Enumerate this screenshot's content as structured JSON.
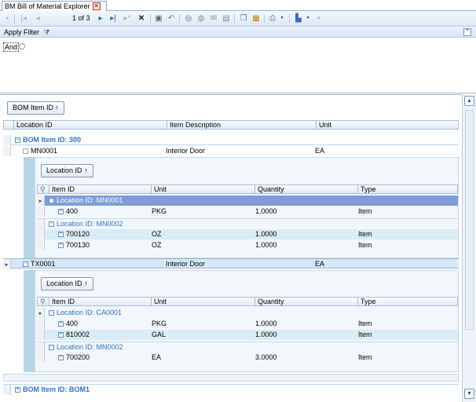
{
  "tab": {
    "title": "BM Bill of Material Explorer"
  },
  "pager": {
    "text": "1 of 3"
  },
  "filter": {
    "title": "Apply Filter",
    "and_label": "And"
  },
  "grid": {
    "group_by_label": "BOM Item ID",
    "columns": [
      "Location ID",
      "Item Description",
      "Unit"
    ],
    "groups": [
      {
        "label": "BOM Item ID: 300"
      },
      {
        "label": "BOM Item ID: BOM1"
      }
    ],
    "rows": [
      {
        "location": "MN0001",
        "description": "Interior Door",
        "unit": "EA"
      },
      {
        "location": "TX0001",
        "description": "Interior Door",
        "unit": "EA"
      }
    ]
  },
  "sub1": {
    "group_by_label": "Location ID",
    "columns": [
      "Item ID",
      "Unit",
      "Quantity",
      "Type"
    ],
    "group_a": "Location ID: MN0001",
    "group_b": "Location ID: MN0002",
    "rows_a": [
      {
        "item": "400",
        "unit": "PKG",
        "qty": "1.0000",
        "type": "Item"
      }
    ],
    "rows_b": [
      {
        "item": "700120",
        "unit": "OZ",
        "qty": "1.0000",
        "type": "Item"
      },
      {
        "item": "700130",
        "unit": "OZ",
        "qty": "1.0000",
        "type": "Item"
      }
    ]
  },
  "sub2": {
    "group_by_label": "Location ID",
    "columns": [
      "Item ID",
      "Unit",
      "Quantity",
      "Type"
    ],
    "group_a": "Location ID: CA0001",
    "group_b": "Location ID: MN0002",
    "rows_a": [
      {
        "item": "400",
        "unit": "PKG",
        "qty": "1.0000",
        "type": "Item"
      },
      {
        "item": "810002",
        "unit": "GAL",
        "qty": "1.0000",
        "type": "Item"
      }
    ],
    "rows_b": [
      {
        "item": "700200",
        "unit": "EA",
        "qty": "3.0000",
        "type": "Item"
      }
    ]
  }
}
